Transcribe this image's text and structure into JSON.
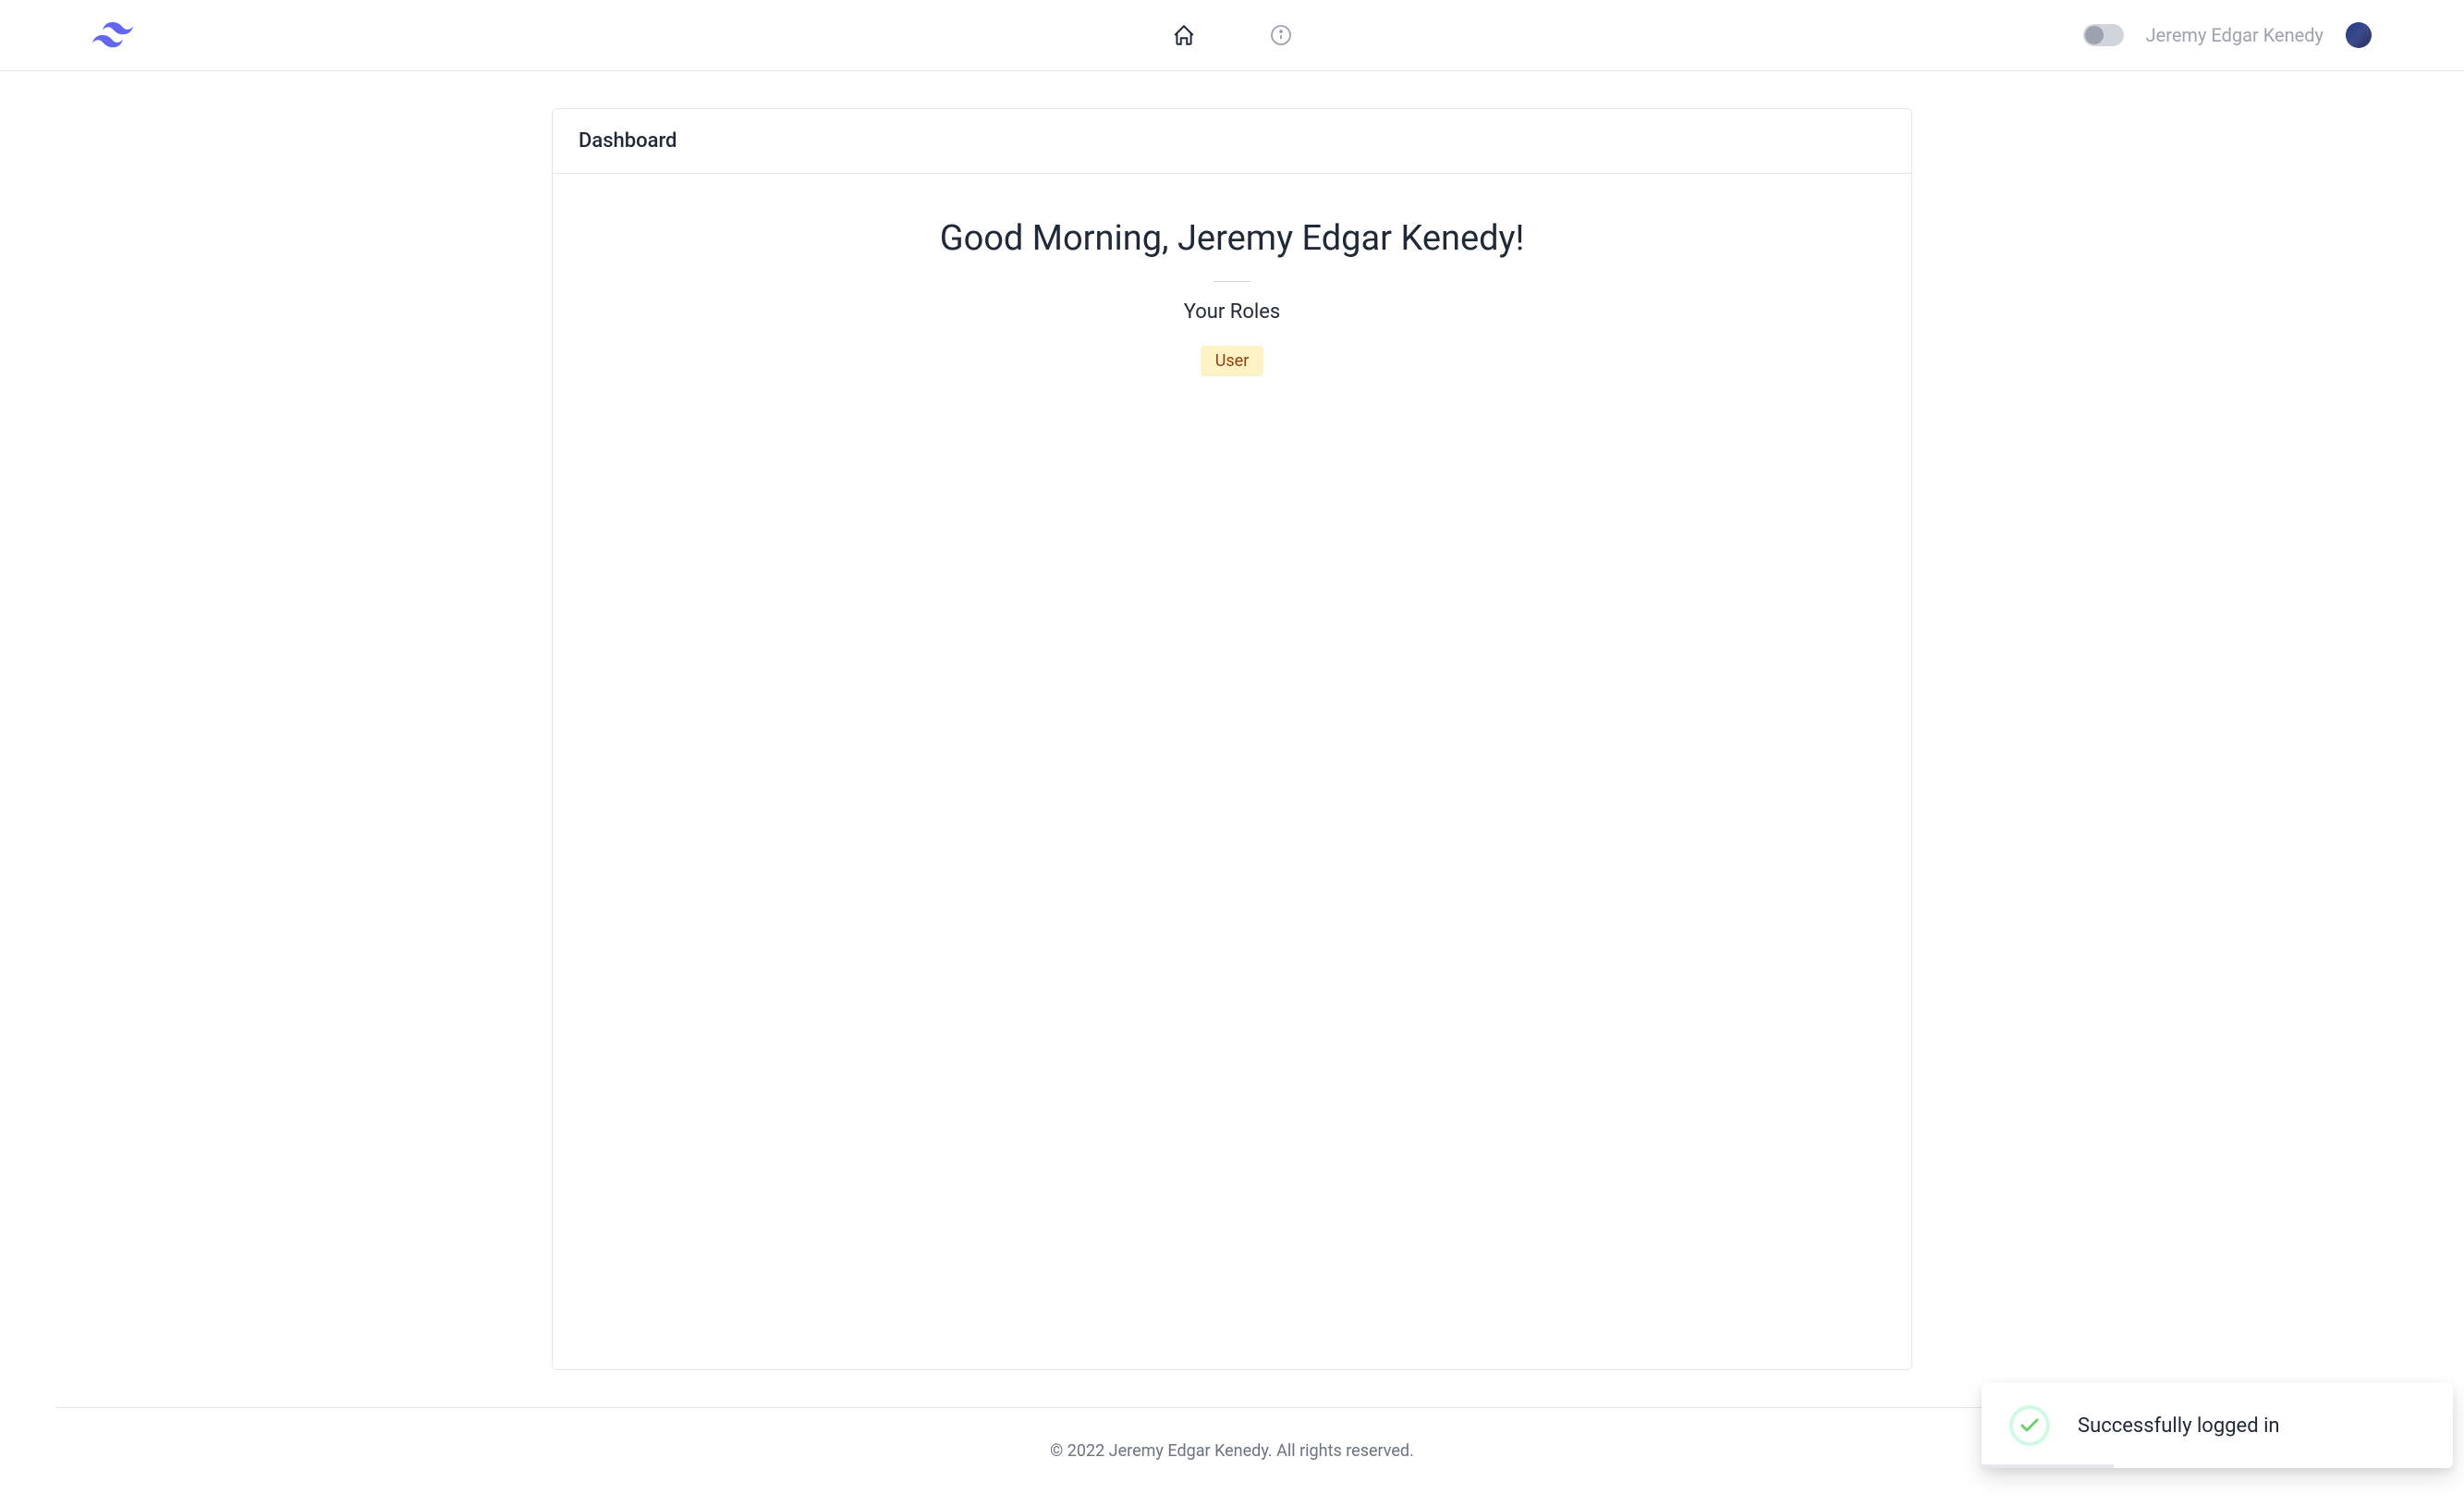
{
  "header": {
    "user_name": "Jeremy Edgar Kenedy"
  },
  "card": {
    "title": "Dashboard",
    "greeting": "Good Morning, Jeremy Edgar Kenedy!",
    "roles_title": "Your Roles",
    "role_badge": "User"
  },
  "footer": {
    "text": "© 2022 Jeremy Edgar Kenedy. All rights reserved."
  },
  "toast": {
    "message": "Successfully logged in"
  },
  "colors": {
    "brand": "#6366f1",
    "badge_bg": "#fef3c7",
    "badge_text": "#92400e",
    "success": "#10b981"
  }
}
